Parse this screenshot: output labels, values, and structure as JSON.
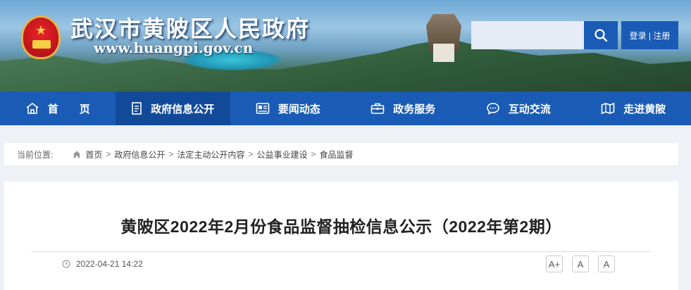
{
  "header": {
    "site_title": "武汉市黄陂区人民政府",
    "site_url": "www.huangpi.gov.cn",
    "search": {
      "placeholder": "",
      "button_icon": "search-icon"
    },
    "login_label": "登录 | 注册",
    "emblem": "national-emblem-icon"
  },
  "nav": {
    "items": [
      {
        "label": "首　　页",
        "icon": "home-icon"
      },
      {
        "label": "政府信息公开",
        "icon": "document-icon",
        "active": true
      },
      {
        "label": "要闻动态",
        "icon": "news-icon"
      },
      {
        "label": "政务服务",
        "icon": "briefcase-icon"
      },
      {
        "label": "互动交流",
        "icon": "chat-icon"
      },
      {
        "label": "走进黄陂",
        "icon": "map-icon"
      }
    ]
  },
  "breadcrumb": {
    "label": "当前位置:",
    "items": [
      "首页",
      "政府信息公开",
      "法定主动公开内容",
      "公益事业建设",
      "食品监督"
    ],
    "separator": ">"
  },
  "article": {
    "title": "黄陂区2022年2月份食品监督抽检信息公示（2022年第2期）",
    "date": "2022-04-21 14:22",
    "font_sizes": [
      "A+",
      "A",
      "A"
    ]
  },
  "colors": {
    "primary_blue": "#1a5bb5",
    "active_nav": "#124a9a",
    "page_bg": "#eef1f5"
  }
}
